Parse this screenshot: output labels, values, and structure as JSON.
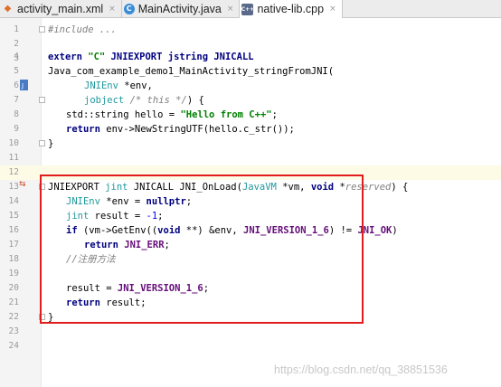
{
  "tabs": [
    {
      "label": "activity_main.xml",
      "icon": "xml-file-icon",
      "active": false
    },
    {
      "label": "MainActivity.java",
      "icon": "java-class-icon",
      "active": false
    },
    {
      "label": "native-lib.cpp",
      "icon": "cpp-file-icon",
      "active": true
    }
  ],
  "tab_icons": {
    "java": "C",
    "cpp": "C++",
    "close": "×",
    "xml": "◆"
  },
  "line_numbers": [
    "1",
    "2",
    "3",
    "4",
    "5",
    "6",
    "7",
    "8",
    "9",
    "10",
    "11",
    "12",
    "13",
    "14",
    "15",
    "16",
    "17",
    "18",
    "19",
    "20",
    "21",
    "22",
    "23",
    "24"
  ],
  "code": {
    "include": "#include ...",
    "extern_kw": "extern",
    "extern_str": "\"C\"",
    "extern_macros": " JNIEXPORT jstring JNICALL",
    "fn_name": "Java_com_example_demo1_MainActivity_stringFromJNI(",
    "p1_type": "JNIEnv",
    "p1_rest": " *env,",
    "p2_type": "jobject",
    "p2_comment": " /* this */",
    "p2_rest": ") {",
    "l9_a": "std::string hello = ",
    "l9_str": "\"Hello from C++\"",
    "l9_b": ";",
    "l10_kw": "return",
    "l10_rest": " env->NewStringUTF(hello.c_str());",
    "l11": "}",
    "l13_a": "JNIEXPORT ",
    "l13_t": "jint",
    "l13_b": " JNICALL JNI_OnLoad(",
    "l13_t2": "JavaVM",
    "l13_c": " *vm, ",
    "l13_kw": "void",
    "l13_d": " *",
    "l13_cm": "reserved",
    "l13_e": ") {",
    "l14_t": "JNIEnv",
    "l14_a": " *env = ",
    "l14_kw": "nullptr",
    "l14_b": ";",
    "l15_t": "jint",
    "l15_a": " result = ",
    "l15_n": "-1",
    "l15_b": ";",
    "l16_kw": "if",
    "l16_a": " (vm->GetEnv((",
    "l16_kw2": "void",
    "l16_b": " **) &env, ",
    "l16_m": "JNI_VERSION_1_6",
    "l16_c": ") != ",
    "l16_m2": "JNI_OK",
    "l16_d": ")",
    "l17_kw": "return",
    "l17_sp": " ",
    "l17_m": "JNI_ERR",
    "l17_b": ";",
    "l18_comment": "//注册方法",
    "l20_a": "result = ",
    "l20_m": "JNI_VERSION_1_6",
    "l20_b": ";",
    "l21_kw": "return",
    "l21_a": " result;",
    "l22": "}"
  },
  "gutter_icons": {
    "l13": "⇆"
  },
  "watermark": "https://blog.csdn.net/qq_38851536",
  "colors": {
    "keyword": "#000080",
    "type": "#20999d",
    "string": "#008000",
    "macro": "#660e7a",
    "comment": "#808080",
    "highlight": "#e01c1c"
  }
}
